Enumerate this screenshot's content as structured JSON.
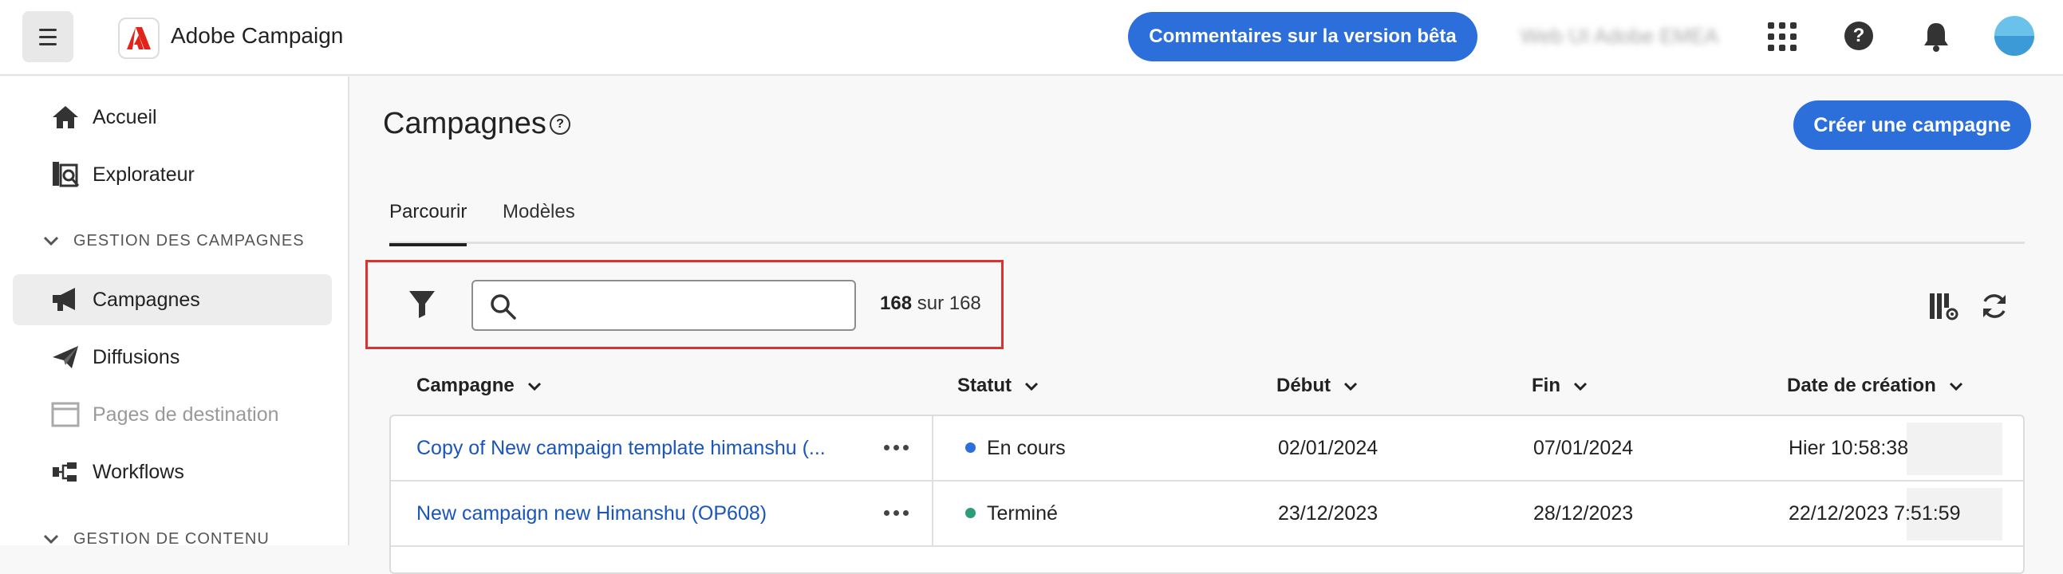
{
  "topbar": {
    "app_name": "Adobe Campaign",
    "beta_button": "Commentaires sur la version bêta",
    "org_name": "Web UI Adobe EMEA",
    "help_glyph": "?"
  },
  "sidebar": {
    "items": [
      {
        "label": "Accueil",
        "icon": "home-icon"
      },
      {
        "label": "Explorateur",
        "icon": "explorer-icon"
      },
      {
        "label": "Campagnes",
        "icon": "megaphone-icon",
        "active": true
      },
      {
        "label": "Diffusions",
        "icon": "paper-plane-icon"
      },
      {
        "label": "Pages de destination",
        "icon": "landing-page-icon",
        "disabled": true
      },
      {
        "label": "Workflows",
        "icon": "workflow-icon"
      }
    ],
    "sections": [
      "GESTION DES CAMPAGNES",
      "GESTION DE CONTENU"
    ]
  },
  "main": {
    "title": "Campagnes",
    "title_help": "?",
    "create_button": "Créer une campagne",
    "tabs": [
      {
        "label": "Parcourir",
        "active": true
      },
      {
        "label": "Modèles"
      }
    ],
    "count_bold": "168",
    "count_rest": " sur 168",
    "columns": [
      "Campagne",
      "Statut",
      "Début",
      "Fin",
      "Date de création"
    ],
    "rows": [
      {
        "campaign": "Copy of New campaign template himanshu (...",
        "status": "En cours",
        "status_color": "#2c6fda",
        "start": "02/01/2024",
        "end": "07/01/2024",
        "created": "Hier 10:58:38"
      },
      {
        "campaign": "New campaign new Himanshu (OP608)",
        "status": "Terminé",
        "status_color": "#2d9d78",
        "start": "23/12/2023",
        "end": "28/12/2023",
        "created": "22/12/2023 7:51:59"
      }
    ]
  },
  "colors": {
    "accent": "#2c6fda",
    "highlight": "#d9332f",
    "link": "#1a56b8"
  }
}
